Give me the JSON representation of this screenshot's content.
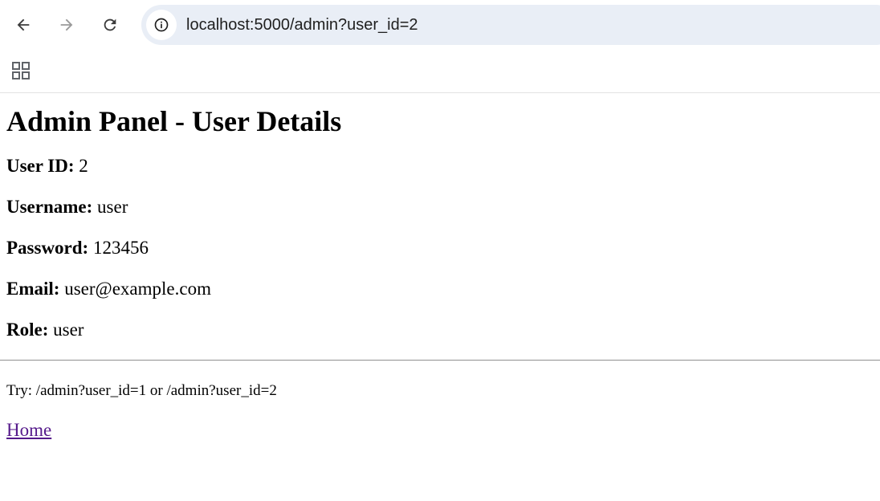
{
  "browser": {
    "url": "localhost:5000/admin?user_id=2"
  },
  "page": {
    "title": "Admin Panel - User Details",
    "fields": [
      {
        "label": "User ID:",
        "value": "2"
      },
      {
        "label": "Username:",
        "value": "user"
      },
      {
        "label": "Password:",
        "value": "123456"
      },
      {
        "label": "Email:",
        "value": "user@example.com"
      },
      {
        "label": "Role:",
        "value": "user"
      }
    ],
    "hint": "Try: /admin?user_id=1 or /admin?user_id=2",
    "home_link": "Home"
  },
  "icons": {
    "back": "arrow-left-icon",
    "forward": "arrow-right-icon",
    "reload": "reload-icon",
    "site_info": "info-icon",
    "apps": "apps-grid-icon"
  },
  "colors": {
    "omnibox_bg": "#e9eef6",
    "visited_link": "#551a8b"
  }
}
